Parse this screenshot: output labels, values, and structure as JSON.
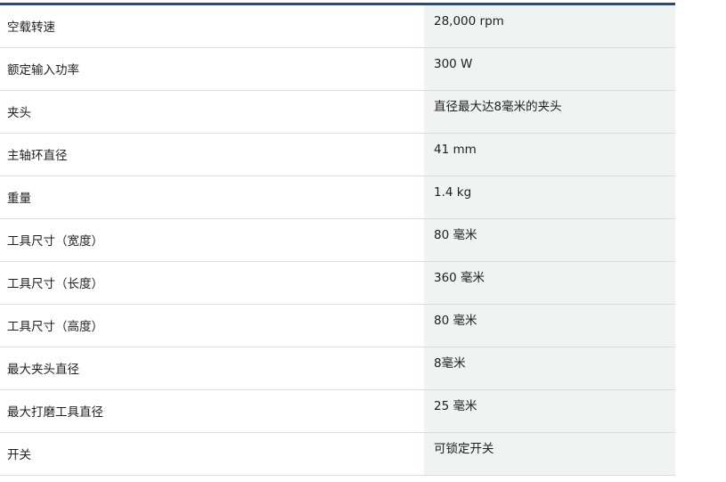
{
  "specs": [
    {
      "label": "空载转速",
      "value": "28,000 rpm"
    },
    {
      "label": "额定输入功率",
      "value": "300 W"
    },
    {
      "label": "夹头",
      "value": "直径最大达8毫米的夹头"
    },
    {
      "label": "主轴环直径",
      "value": "41 mm"
    },
    {
      "label": "重量",
      "value": "1.4 kg"
    },
    {
      "label": "工具尺寸（宽度）",
      "value": "80 毫米"
    },
    {
      "label": "工具尺寸（长度）",
      "value": "360 毫米"
    },
    {
      "label": "工具尺寸（高度）",
      "value": "80 毫米"
    },
    {
      "label": "最大夹头直径",
      "value": "8毫米"
    },
    {
      "label": "最大打磨工具直径",
      "value": "25 毫米"
    },
    {
      "label": "开关",
      "value": "可锁定开关"
    }
  ],
  "colors": {
    "accent_rule": "#1d4f86",
    "value_background": "#f1f2f2",
    "divider": "#d9dcdd"
  }
}
